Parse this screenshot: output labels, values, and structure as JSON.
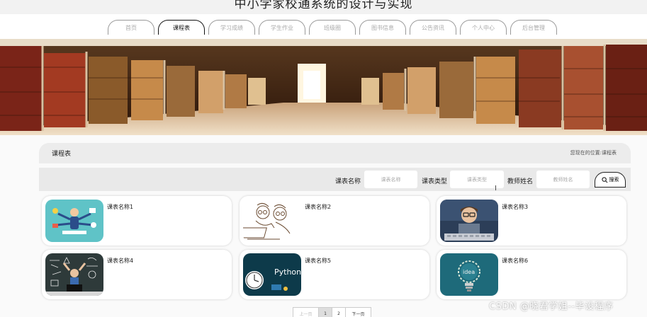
{
  "site": {
    "title": "中小学家校通系统的设计与实现"
  },
  "nav": {
    "active_index": 1,
    "items": [
      "首页",
      "课程表",
      "学习成绩",
      "学生作业",
      "班级圈",
      "图书信息",
      "公告资讯",
      "个人中心",
      "后台管理"
    ]
  },
  "page": {
    "title": "课程表",
    "breadcrumb_prefix": "您现在的位置:",
    "breadcrumb_current": "课程表"
  },
  "search": {
    "fields": [
      {
        "label": "课表名称",
        "placeholder": "课表名称"
      },
      {
        "label": "课表类型",
        "placeholder": "课表类型"
      },
      {
        "label": "教师姓名",
        "placeholder": "教师姓名"
      }
    ],
    "button_label": "搜索"
  },
  "cards": [
    {
      "name": "课表名称1"
    },
    {
      "name": "课表名称2"
    },
    {
      "name": "课表名称3"
    },
    {
      "name": "课表名称4"
    },
    {
      "name": "课表名称5",
      "thumb_text": "Python"
    },
    {
      "name": "课表名称6",
      "thumb_text": "idea"
    }
  ],
  "pagination": {
    "prev": "上一页",
    "pages": [
      "1",
      "2"
    ],
    "current": "1",
    "next": "下一页"
  },
  "watermark": "CSDN @晓君学姐--毕设程序",
  "colors": {
    "nav_active": "#111111",
    "card_bg": "#ffffff",
    "search_bar": "#e9e9e9"
  }
}
